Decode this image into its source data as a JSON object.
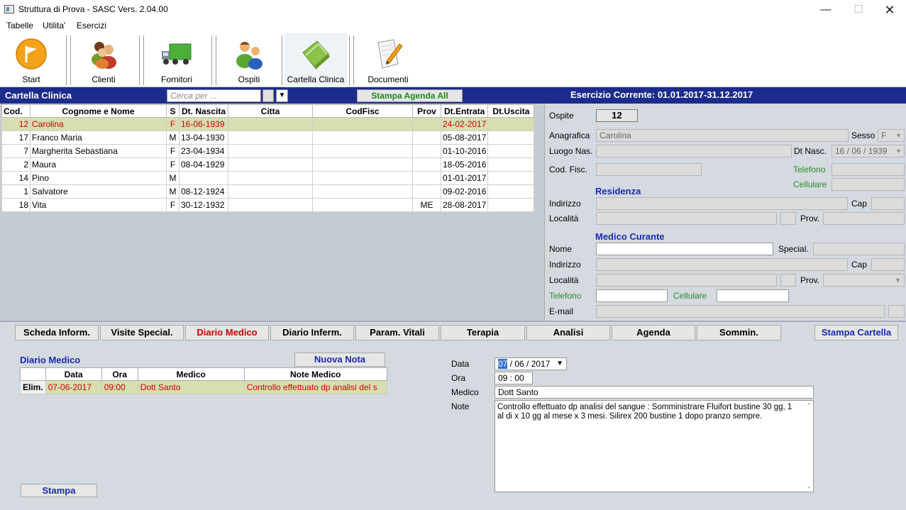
{
  "window": {
    "title": "Struttura di Prova - SASC Vers. 2.04.00"
  },
  "menu": [
    "Tabelle",
    "Utilita'",
    "Esercizi"
  ],
  "toolbar": {
    "start": "Start",
    "clienti": "Clienti",
    "fornitori": "Fornitori",
    "ospiti": "Ospiti",
    "cartella": "Cartella Clinica",
    "documenti": "Documenti"
  },
  "header": {
    "section_title": "Cartella Clinica",
    "search_placeholder": "Cerca per ...",
    "stampa_agenda": "Stampa Agenda All",
    "esercizio": "Esercizio Corrente: 01.01.2017-31.12.2017"
  },
  "grid": {
    "columns": [
      "Cod.",
      "Cognome e Nome",
      "S",
      "Dt. Nascita",
      "Citta",
      "CodFisc",
      "Prov",
      "Dt.Entrata",
      "Dt.Uscita"
    ],
    "rows": [
      {
        "cod": "12",
        "nome": "Carolina",
        "s": "F",
        "nascita": "16-06-1939",
        "citta": "",
        "codfisc": "",
        "prov": "",
        "entrata": "24-02-2017",
        "uscita": ""
      },
      {
        "cod": "17",
        "nome": "Franco Maria",
        "s": "M",
        "nascita": "13-04-1930",
        "citta": "",
        "codfisc": "",
        "prov": "",
        "entrata": "05-08-2017",
        "uscita": ""
      },
      {
        "cod": "7",
        "nome": "Margherita Sebastiana",
        "s": "F",
        "nascita": "23-04-1934",
        "citta": "",
        "codfisc": "",
        "prov": "",
        "entrata": "01-10-2016",
        "uscita": ""
      },
      {
        "cod": "2",
        "nome": "Maura",
        "s": "F",
        "nascita": "08-04-1929",
        "citta": "",
        "codfisc": "",
        "prov": "",
        "entrata": "18-05-2016",
        "uscita": ""
      },
      {
        "cod": "14",
        "nome": "Pino",
        "s": "M",
        "nascita": "",
        "citta": "",
        "codfisc": "",
        "prov": "",
        "entrata": "01-01-2017",
        "uscita": ""
      },
      {
        "cod": "1",
        "nome": "Salvatore",
        "s": "M",
        "nascita": "08-12-1924",
        "citta": "",
        "codfisc": "",
        "prov": "",
        "entrata": "09-02-2016",
        "uscita": ""
      },
      {
        "cod": "18",
        "nome": "Vita",
        "s": "F",
        "nascita": "30-12-1932",
        "citta": "",
        "codfisc": "",
        "prov": "ME",
        "entrata": "28-08-2017",
        "uscita": ""
      }
    ]
  },
  "detail": {
    "ospite_label": "Ospite",
    "ospite_value": "12",
    "anagrafica_label": "Anagrafica",
    "anagrafica_value": "Carolina",
    "sesso_label": "Sesso",
    "sesso_value": "F",
    "luogo_label": "Luogo Nas.",
    "dtnasc_label": "Dt Nasc.",
    "dtnasc_value": "16 / 06 / 1939",
    "codfisc_label": "Cod. Fisc.",
    "telefono_label": "Telefono",
    "cellulare_label": "Cellulare",
    "residenza_title": "Residenza",
    "indirizzo_label": "Indirizzo",
    "cap_label": "Cap",
    "localita_label": "Località",
    "prov_label": "Prov.",
    "medico_title": "Medico Curante",
    "nome_label": "Nome",
    "special_label": "Special.",
    "email_label": "E-mail"
  },
  "tabs": [
    "Scheda Inform.",
    "Visite Special.",
    "Diario Medico",
    "Diario Inferm.",
    "Param. Vitali",
    "Terapia",
    "Analisi",
    "Agenda",
    "Sommin."
  ],
  "stampa_cartella": "Stampa Cartella",
  "diario": {
    "title": "Diario Medico",
    "nuova_nota": "Nuova Nota",
    "columns": [
      "Data",
      "Ora",
      "Medico",
      "Note Medico"
    ],
    "row": {
      "elim": "Elim.",
      "data": "07-06-2017",
      "ora": "09:00",
      "medico": "Dott Santo",
      "note": "Controllo effettuato dp analisi del s"
    },
    "stampa": "Stampa"
  },
  "form": {
    "data_label": "Data",
    "data_day": "07",
    "data_rest": " / 06 / 2017",
    "ora_label": "Ora",
    "ora_value": "09 : 00",
    "medico_label": "Medico",
    "medico_value": "Dott Santo",
    "note_label": "Note",
    "note_value": "Controllo effettuato dp analisi del sangue : Somministrare Fluifort bustine 30 gg, 1 al di x 10 gg al mese x 3 mesi. Silirex 200 bustine 1 dopo pranzo sempre."
  }
}
